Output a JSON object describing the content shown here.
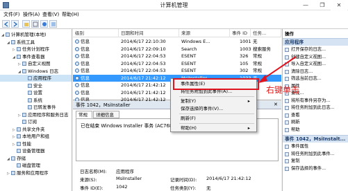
{
  "window": {
    "title": "计算机管理",
    "controls": [
      "—",
      "❐",
      "✕"
    ]
  },
  "menu": [
    "文件(F)",
    "操作(A)",
    "查看(V)",
    "帮助(H)"
  ],
  "tree": [
    {
      "label": "计算机管理(本地)",
      "indent": 0,
      "toggle": "◢"
    },
    {
      "label": "系统工具",
      "indent": 1,
      "toggle": "◢"
    },
    {
      "label": "任务计划程序",
      "indent": 2,
      "toggle": "▷"
    },
    {
      "label": "事件查看器",
      "indent": 2,
      "toggle": "◢"
    },
    {
      "label": "自定义视图",
      "indent": 3,
      "toggle": "▷"
    },
    {
      "label": "Windows 日志",
      "indent": 3,
      "toggle": "◢"
    },
    {
      "label": "应用程序",
      "indent": 4,
      "toggle": "",
      "selected": true
    },
    {
      "label": "安全",
      "indent": 4,
      "toggle": ""
    },
    {
      "label": "设置",
      "indent": 4,
      "toggle": ""
    },
    {
      "label": "系统",
      "indent": 4,
      "toggle": ""
    },
    {
      "label": "已转发事件",
      "indent": 4,
      "toggle": ""
    },
    {
      "label": "应用程序和服务日志",
      "indent": 3,
      "toggle": "▷"
    },
    {
      "label": "订阅",
      "indent": 3,
      "toggle": ""
    },
    {
      "label": "共享文件夹",
      "indent": 2,
      "toggle": "▷"
    },
    {
      "label": "本地用户和组",
      "indent": 2,
      "toggle": "▷"
    },
    {
      "label": "性能",
      "indent": 2,
      "toggle": "▷"
    },
    {
      "label": "设备管理器",
      "indent": 2,
      "toggle": ""
    },
    {
      "label": "存储",
      "indent": 1,
      "toggle": "◢"
    },
    {
      "label": "磁盘管理",
      "indent": 2,
      "toggle": ""
    },
    {
      "label": "服务和应用程序",
      "indent": 1,
      "toggle": "▷"
    }
  ],
  "list": {
    "headers": [
      "级别",
      "日期和时间",
      "来源",
      "事件 ID",
      "任务..."
    ],
    "rows": [
      {
        "level": "信息",
        "datetime": "2014/6/17 22:10:30",
        "source": "Windows E...",
        "id": "1001",
        "task": "无"
      },
      {
        "level": "信息",
        "datetime": "2014/6/17 22:09:10",
        "source": "Search",
        "id": "1003",
        "task": "搜索服务"
      },
      {
        "level": "信息",
        "datetime": "2014/6/17 22:04:53",
        "source": "ESENT",
        "id": "326",
        "task": "常规"
      },
      {
        "level": "信息",
        "datetime": "2014/6/17 22:04:53",
        "source": "ESENT",
        "id": "105",
        "task": "常规"
      },
      {
        "level": "信息",
        "datetime": "2014/6/17 22:04:53",
        "source": "ESENT",
        "id": "302",
        "task": "常规"
      },
      {
        "level": "信息",
        "datetime": "2014/6/17 21:42:12",
        "source": "MsiInstaller",
        "id": "1033",
        "task": "无",
        "selected": true
      },
      {
        "level": "信息",
        "datetime": "2014/6/17 21:42:12",
        "source": "",
        "id": "",
        "task": ""
      },
      {
        "level": "信息",
        "datetime": "2014/6/17 21:42:12",
        "source": "",
        "id": "",
        "task": ""
      },
      {
        "level": "信息",
        "datetime": "2014/6/17 21:42:12",
        "source": "",
        "id": "",
        "task": ""
      }
    ]
  },
  "detail": {
    "header": "事件 1042，MsiInstaller",
    "tabs": [
      "常规",
      "详细信息"
    ],
    "description": "已在结束 Windows Installer 事务 (AC768A86-7A... 程序 ID: 9716。",
    "fields": {
      "log_label": "日志名称(M):",
      "log_value": "应用程序",
      "source_label": "来源(S):",
      "source_value": "MsiInstaller",
      "recorded_label": "记录时间(D):",
      "recorded_value": "2014/6/17 21:42:12",
      "id_label": "事件 ID(E):",
      "id_value": "1042",
      "task_label": "任务类别(Y):",
      "task_value": "无"
    }
  },
  "context_menu": [
    {
      "label": "事件属性(E)"
    },
    {
      "label": "将任务附加到此事件(A)..."
    },
    {
      "sep": true
    },
    {
      "label": "复制(Y)",
      "submenu": true
    },
    {
      "label": "保存选择的事件(V)..."
    },
    {
      "sep": true
    },
    {
      "label": "刷新(F)"
    },
    {
      "sep": true
    },
    {
      "label": "帮助(H)",
      "submenu": true
    }
  ],
  "actions": {
    "title": "操作",
    "sections": [
      {
        "name": "应用程序",
        "items": [
          "打开保存的日志...",
          "创建自定义视图...",
          "导入自定义视图...",
          "清除日志...",
          "筛选当前日志...",
          "属性",
          "查找...",
          "将所有事件另存为...",
          "将任务附加到此日志...",
          "查看",
          "刷新",
          "帮助"
        ]
      },
      {
        "name": "事件 1042，MsiInstalt...",
        "items": [
          "事件属性",
          "将任务附加到此事件...",
          "复制",
          "保存选择的事件..."
        ]
      }
    ]
  },
  "annotation": "右键单击",
  "colors": {
    "highlight": "#e0141e",
    "selection": "#3399ff",
    "section": "#d5e3f3"
  }
}
